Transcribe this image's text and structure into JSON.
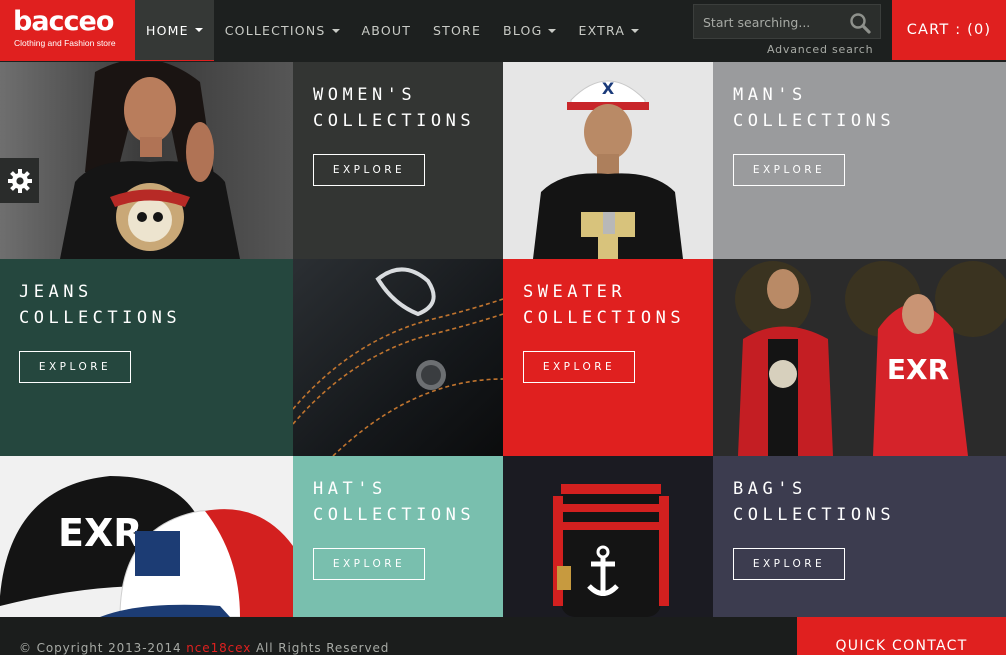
{
  "brand": {
    "name": "bacceo",
    "tagline": "Clothing and Fashion store",
    "accent": "#e0201f"
  },
  "nav": {
    "items": [
      {
        "label": "HOME",
        "dropdown": true,
        "active": true
      },
      {
        "label": "COLLECTIONS",
        "dropdown": true
      },
      {
        "label": "ABOUT",
        "dropdown": false
      },
      {
        "label": "STORE",
        "dropdown": false
      },
      {
        "label": "BLOG",
        "dropdown": true
      },
      {
        "label": "EXTRA",
        "dropdown": true
      }
    ]
  },
  "search": {
    "placeholder": "Start searching...",
    "advanced_label": "Advanced search",
    "icon": "search-icon"
  },
  "cart": {
    "label": "CART : (0)"
  },
  "tiles": {
    "women": {
      "line1": "WOMEN'S",
      "line2": "COLLECTIONS",
      "button": "EXPLORE",
      "color": "#333533"
    },
    "man": {
      "line1": "MAN'S",
      "line2": "COLLECTIONS",
      "button": "EXPLORE",
      "color": "#9a9b9d"
    },
    "jeans": {
      "line1": "JEANS",
      "line2": "COLLECTIONS",
      "button": "EXPLORE",
      "color": "#25473e"
    },
    "sweater": {
      "line1": "SWEATER",
      "line2": "COLLECTIONS",
      "button": "EXPLORE",
      "color": "#e0201f"
    },
    "hats": {
      "line1": "HAT'S",
      "line2": "COLLECTIONS",
      "button": "EXPLORE",
      "color": "#79bfae"
    },
    "bags": {
      "line1": "BAG'S",
      "line2": "COLLECTIONS",
      "button": "EXPLORE",
      "color": "#3c3c4f"
    }
  },
  "settings": {
    "icon": "gear-icon"
  },
  "footer": {
    "copyright_prefix": "© Copyright 2013-2014",
    "copyright_link": "nce18cex",
    "copyright_suffix": "All Rights Reserved",
    "quick_contact": "QUICK CONTACT"
  }
}
